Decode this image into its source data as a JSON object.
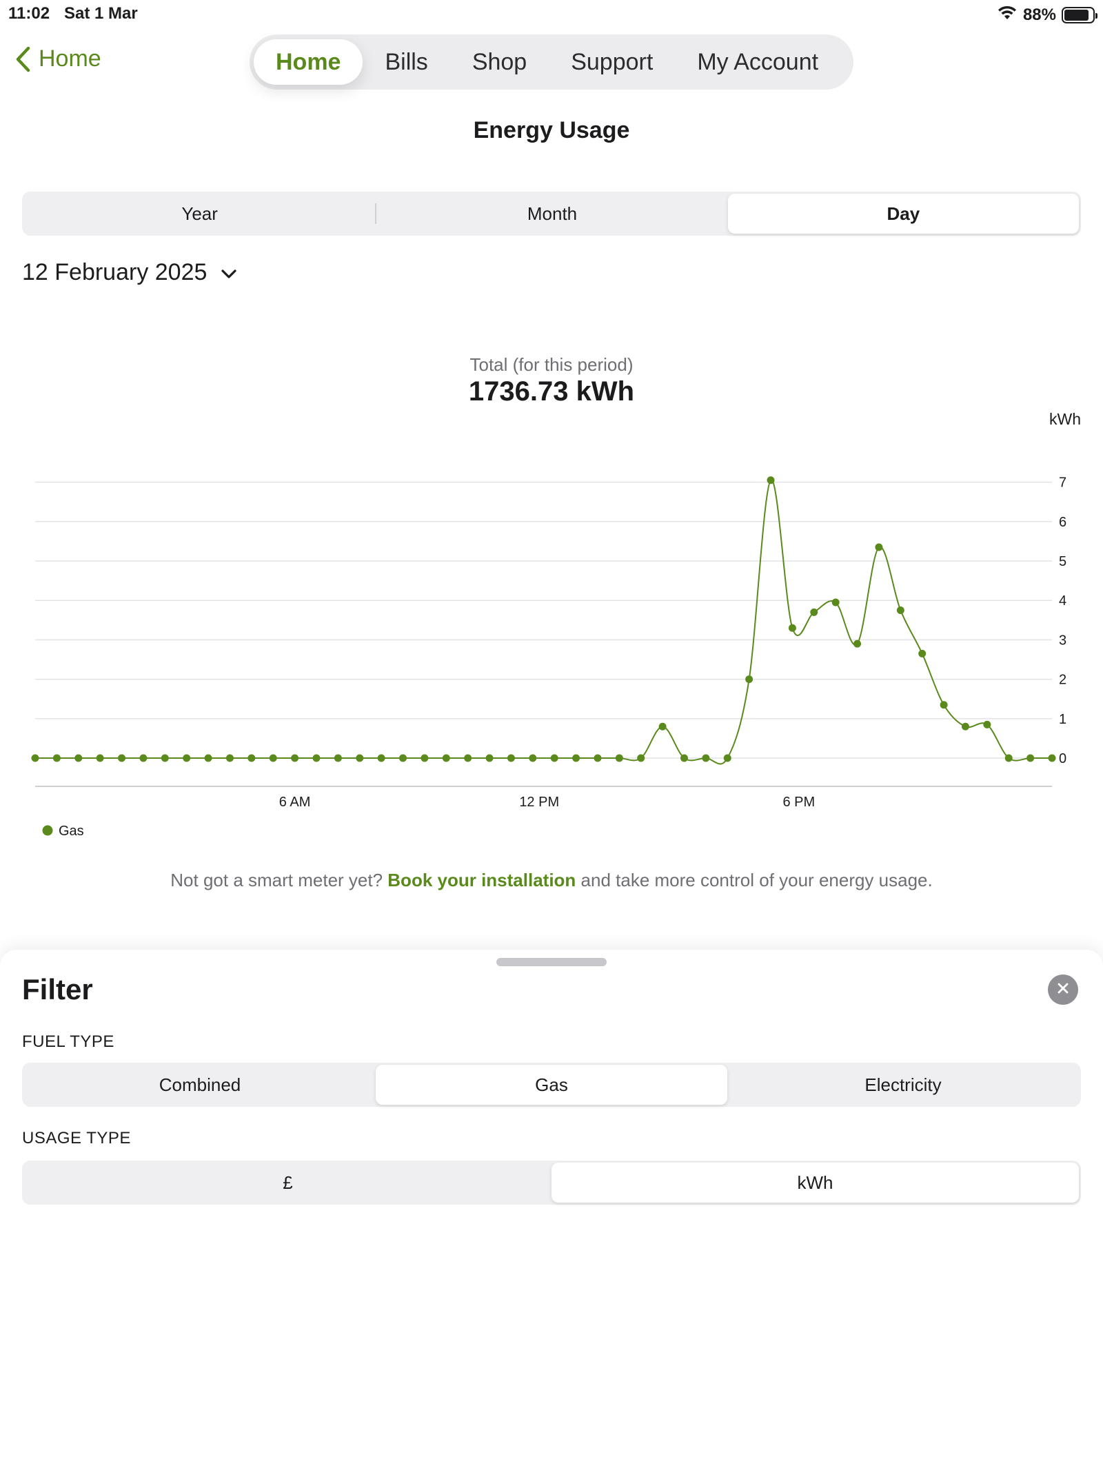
{
  "status_bar": {
    "time": "11:02",
    "date": "Sat 1 Mar",
    "battery": "88%",
    "battery_level": 0.88,
    "wifi_icon": "wifi-icon",
    "battery_icon": "battery-icon"
  },
  "nav": {
    "back_label": "Home",
    "back_icon": "chevron-left-icon",
    "tabs": [
      {
        "label": "Home",
        "active": true
      },
      {
        "label": "Bills",
        "active": false
      },
      {
        "label": "Shop",
        "active": false
      },
      {
        "label": "Support",
        "active": false
      },
      {
        "label": "My Account",
        "active": false
      }
    ]
  },
  "page_title": "Energy Usage",
  "period": {
    "options": [
      "Year",
      "Month",
      "Day"
    ],
    "selected": "Day"
  },
  "date_selector": {
    "value": "12 February 2025",
    "icon": "chevron-down-icon"
  },
  "total": {
    "label": "Total (for this period)",
    "value": "1736.73 kWh"
  },
  "chart_data": {
    "type": "line",
    "ylabel": "kWh",
    "ylim": [
      0,
      7
    ],
    "yticks": [
      "0",
      "1",
      "2",
      "3",
      "4",
      "5",
      "6",
      "7"
    ],
    "xticks": [
      "6 AM",
      "12 PM",
      "6 PM"
    ],
    "grid": true,
    "legend_position": "bottom-left",
    "series": [
      {
        "name": "Gas",
        "color": "#5a8a1c",
        "values": [
          0,
          0,
          0,
          0,
          0,
          0,
          0,
          0,
          0,
          0,
          0,
          0,
          0,
          0,
          0,
          0,
          0,
          0,
          0,
          0,
          0,
          0,
          0,
          0,
          0,
          0,
          0,
          0,
          0,
          0.8,
          0,
          0,
          0,
          2.0,
          7.05,
          3.3,
          3.7,
          3.95,
          2.9,
          5.35,
          3.75,
          2.65,
          1.35,
          0.8,
          0.85,
          0,
          0,
          0
        ]
      }
    ]
  },
  "promo": {
    "prefix": "Not got a smart meter yet? ",
    "link": "Book your installation",
    "suffix": " and take more control of your energy usage."
  },
  "filter": {
    "title": "Filter",
    "close_icon": "close-icon",
    "fuel_type_label": "FUEL TYPE",
    "fuel_options": [
      "Combined",
      "Gas",
      "Electricity"
    ],
    "fuel_selected": "Gas",
    "usage_type_label": "USAGE TYPE",
    "usage_options": [
      "£",
      "kWh"
    ],
    "usage_selected": "kWh"
  },
  "colors": {
    "accent": "#5a8a1c",
    "segment_bg": "#efeff1",
    "grid": "#e3e3e6"
  }
}
